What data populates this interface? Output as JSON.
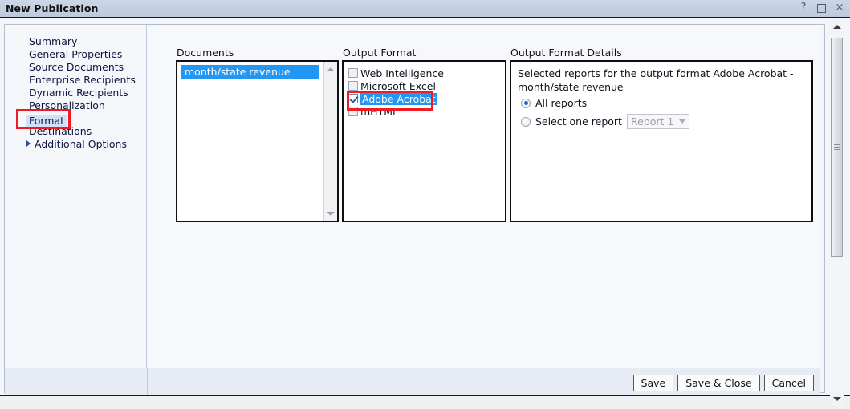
{
  "window": {
    "title": "New Publication",
    "controls": {
      "help": "?",
      "maximize": "maximize-icon",
      "close": "×"
    }
  },
  "sidebar": {
    "items": [
      {
        "label": "Summary",
        "selected": false,
        "arrow": false
      },
      {
        "label": "General Properties",
        "selected": false,
        "arrow": false
      },
      {
        "label": "Source Documents",
        "selected": false,
        "arrow": false
      },
      {
        "label": "Enterprise Recipients",
        "selected": false,
        "arrow": false
      },
      {
        "label": "Dynamic Recipients",
        "selected": false,
        "arrow": false
      },
      {
        "label": "Personalization",
        "selected": false,
        "arrow": false
      },
      {
        "label": "Format",
        "selected": true,
        "arrow": false
      },
      {
        "label": "Destinations",
        "selected": false,
        "arrow": false
      },
      {
        "label": "Additional Options",
        "selected": false,
        "arrow": true
      }
    ]
  },
  "main": {
    "documents": {
      "label": "Documents",
      "items": [
        {
          "label": "month/state revenue",
          "selected": true
        }
      ]
    },
    "output_format": {
      "label": "Output Format",
      "items": [
        {
          "label": "Web Intelligence",
          "checked": false,
          "selected": false
        },
        {
          "label": "Microsoft Excel",
          "checked": false,
          "selected": false
        },
        {
          "label": "Adobe Acrobat",
          "checked": true,
          "selected": true
        },
        {
          "label": "mHTML",
          "checked": false,
          "selected": false
        }
      ]
    },
    "output_format_details": {
      "label": "Output Format Details",
      "description": "Selected reports for the output format Adobe Acrobat - month/state revenue",
      "radio_all_reports": "All reports",
      "radio_select_one": "Select one report",
      "report_dropdown_value": "Report 1",
      "selected_option": "All reports"
    }
  },
  "footer": {
    "save": "Save",
    "save_and_close": "Save & Close",
    "cancel": "Cancel"
  },
  "annotations": {
    "color": "#ee1c24",
    "boxes": [
      "Format",
      "Adobe Acrobat"
    ]
  },
  "colors": {
    "titlebar": "#c5d0e0",
    "selection_blue": "#2196f3",
    "nav_selection": "#cfe0f7",
    "annotation_red": "#ee1c24"
  }
}
